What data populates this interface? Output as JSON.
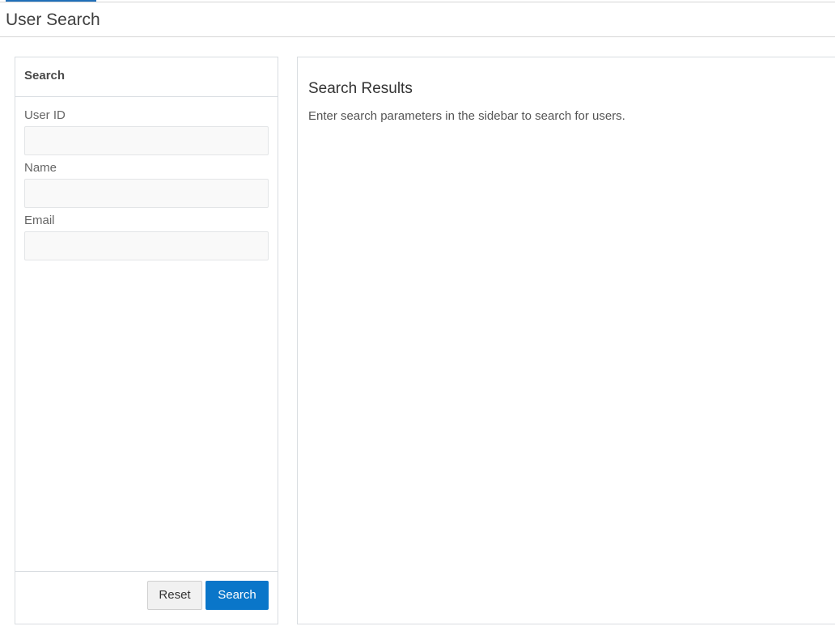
{
  "page": {
    "title": "User Search"
  },
  "sidebar": {
    "title": "Search",
    "fields": [
      {
        "label": "User ID",
        "value": "",
        "placeholder": ""
      },
      {
        "label": "Name",
        "value": "",
        "placeholder": ""
      },
      {
        "label": "Email",
        "value": "",
        "placeholder": ""
      }
    ],
    "reset_label": "Reset",
    "search_label": "Search"
  },
  "results": {
    "title": "Search Results",
    "message": "Enter search parameters in the sidebar to search for users."
  },
  "colors": {
    "primary_button": "#0a76c9",
    "tab_indicator": "#1f6fb8",
    "border": "#d9dde1"
  }
}
